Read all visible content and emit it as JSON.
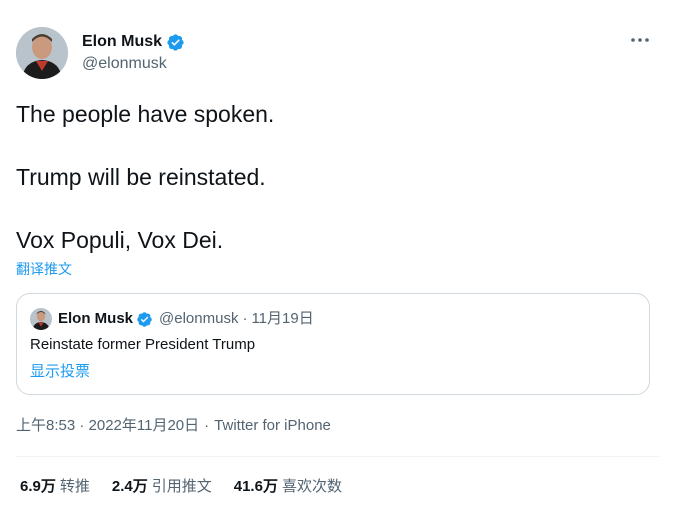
{
  "tweet": {
    "author_name": "Elon Musk",
    "author_handle": "@elonmusk",
    "text_lines": [
      "The people have spoken.",
      "Trump will be reinstated.",
      "Vox Populi, Vox Dei."
    ],
    "translate_label": "翻译推文",
    "timestamp": "上午8:53 · 2022年11月20日",
    "source_separator": "·",
    "source": "Twitter for iPhone"
  },
  "quote": {
    "author_name": "Elon Musk",
    "author_handle": "@elonmusk",
    "date": "11月19日",
    "meta_separator": "·",
    "text": "Reinstate former President Trump",
    "poll_label": "显示投票"
  },
  "stats": [
    {
      "count": "6.9万",
      "label": "转推"
    },
    {
      "count": "2.4万",
      "label": "引用推文"
    },
    {
      "count": "41.6万",
      "label": "喜欢次数"
    }
  ],
  "icons": {
    "verified": "verified-badge-icon",
    "more": "more-options-icon"
  },
  "colors": {
    "accent": "#1d9bf0",
    "text_primary": "#0f1419",
    "text_secondary": "#536471",
    "border": "#cfd9de"
  }
}
